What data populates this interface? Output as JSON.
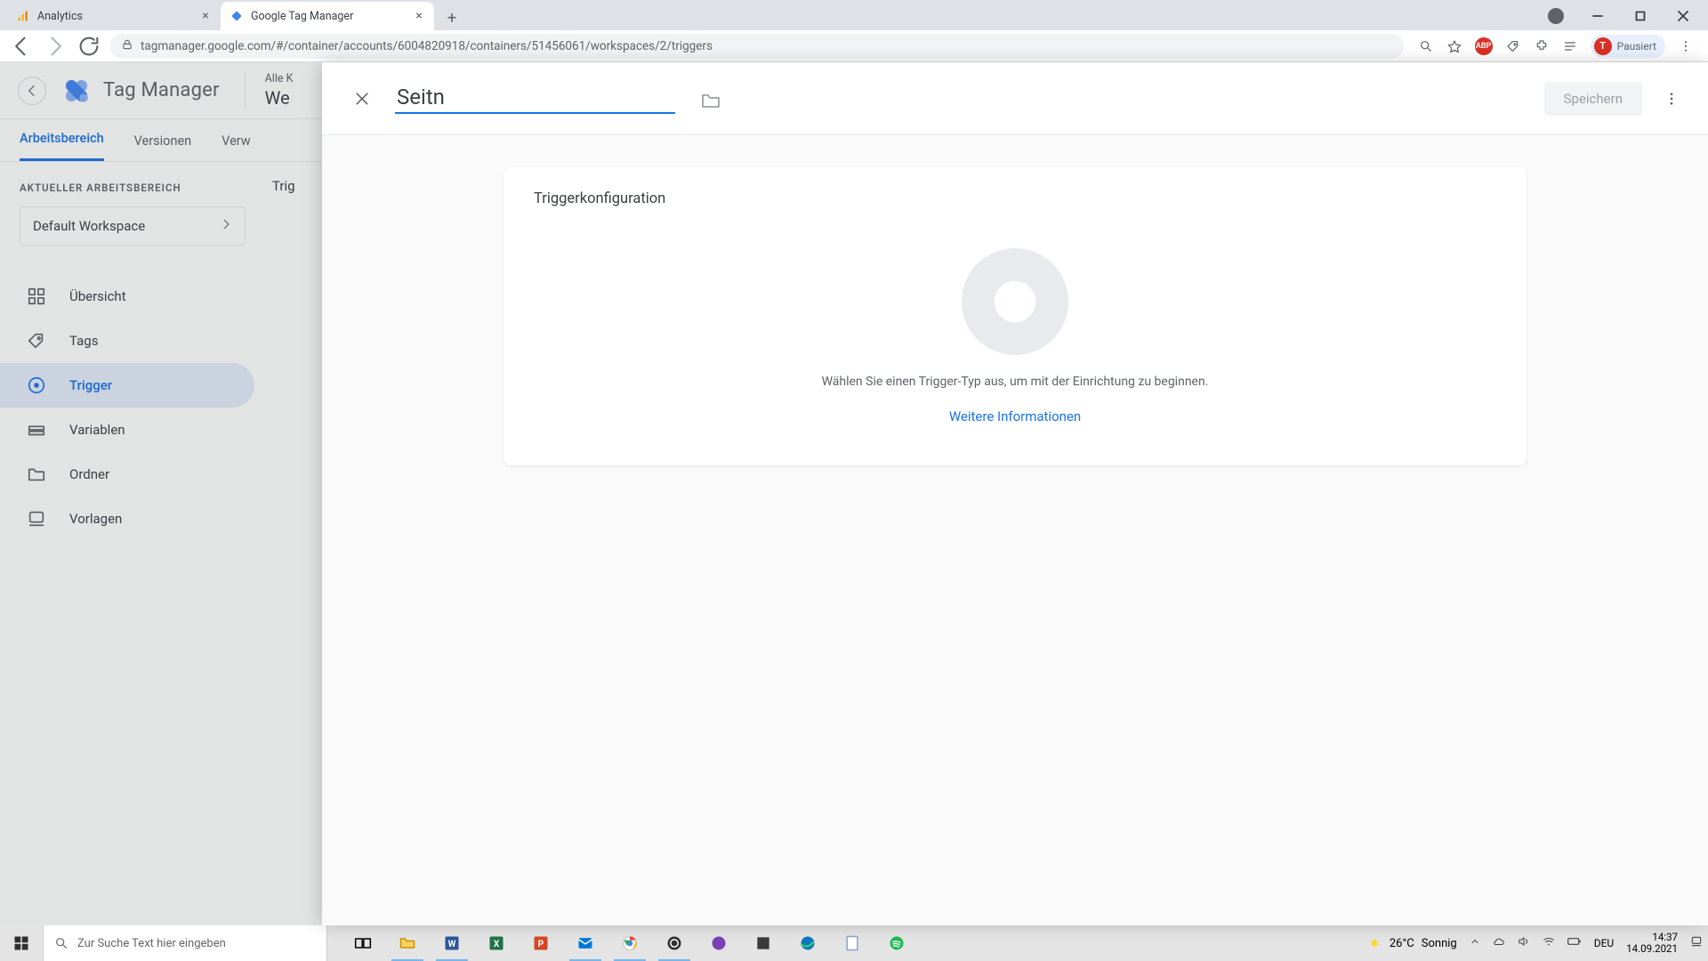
{
  "browser": {
    "tabs": [
      {
        "title": "Analytics"
      },
      {
        "title": "Google Tag Manager"
      }
    ],
    "url": "tagmanager.google.com/#/container/accounts/6004820918/containers/51456061/workspaces/2/triggers",
    "profile_initial": "T",
    "profile_state": "Pausiert"
  },
  "gtm": {
    "product": "Tag Manager",
    "breadcrumb_small": "Alle K",
    "breadcrumb_large": "We",
    "tabs": {
      "workspace": "Arbeitsbereich",
      "versions": "Versionen",
      "admin": "Verw"
    },
    "workspace_label": "AKTUELLER ARBEITSBEREICH",
    "workspace_name": "Default Workspace",
    "nav": {
      "overview": "Übersicht",
      "tags": "Tags",
      "triggers": "Trigger",
      "variables": "Variablen",
      "folders": "Ordner",
      "templates": "Vorlagen"
    },
    "main_heading_partial": "Trig"
  },
  "panel": {
    "name_value": "Seitn",
    "save": "Speichern",
    "card_title": "Triggerkonfiguration",
    "hint": "Wählen Sie einen Trigger-Typ aus, um mit der Einrichtung zu beginnen.",
    "link": "Weitere Informationen"
  },
  "taskbar": {
    "search_placeholder": "Zur Suche Text hier eingeben",
    "weather_temp": "26°C",
    "weather_desc": "Sonnig",
    "lang": "DEU",
    "time": "14:37",
    "date": "14.09.2021"
  }
}
